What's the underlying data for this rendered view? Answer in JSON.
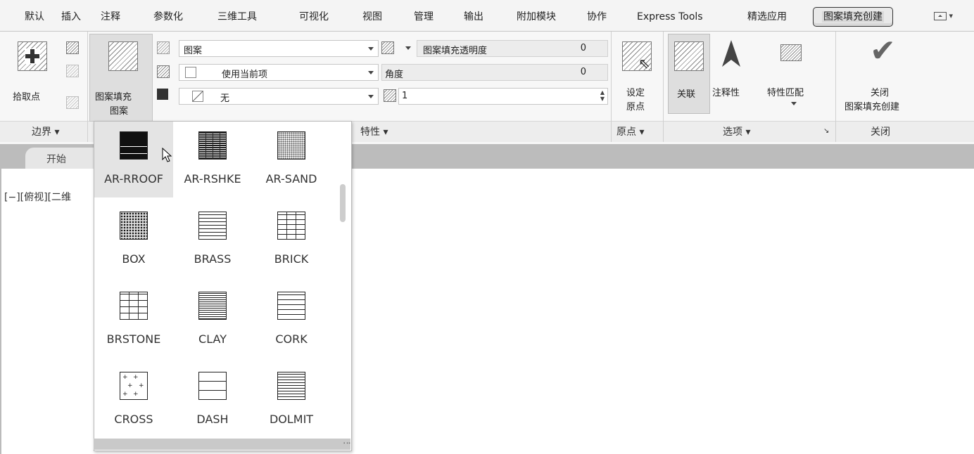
{
  "tabs": [
    "默认",
    "插入",
    "注释",
    "参数化",
    "三维工具",
    "可视化",
    "视图",
    "管理",
    "输出",
    "附加模块",
    "协作",
    "Express Tools",
    "精选应用",
    "图案填充创建"
  ],
  "active_tab": "图案填充创建",
  "boundary": {
    "pick_points_label": "拾取点",
    "title": "边界 ▾"
  },
  "pattern_button": {
    "line1": "图案填充",
    "line2": "图案"
  },
  "properties": {
    "type_value": "图案",
    "color_value": "使用当前项",
    "bg_value": "无",
    "transparency_label": "图案填充透明度",
    "transparency_value": "0",
    "angle_label": "角度",
    "angle_value": "0",
    "scale_value": "1",
    "title": "特性 ▾"
  },
  "origin": {
    "label1": "设定",
    "label2": "原点",
    "title": "原点 ▾"
  },
  "options": {
    "associate": "关联",
    "annotative": "注释性",
    "match": "特性匹配",
    "title": "选项 ▾",
    "launcher": "↘"
  },
  "close_panel": {
    "line1": "关闭",
    "line2": "图案填充创建",
    "title": "关闭"
  },
  "doc_tab": "开始",
  "view_label": "[−][俯视][二维",
  "gallery": {
    "selected": "AR-RROOF",
    "items": [
      "AR-RROOF",
      "AR-RSHKE",
      "AR-SAND",
      "BOX",
      "BRASS",
      "BRICK",
      "BRSTONE",
      "CLAY",
      "CORK",
      "CROSS",
      "DASH",
      "DOLMIT"
    ]
  },
  "icons": [
    "add-point-icon",
    "select-objects-icon",
    "remove-boundary-icon",
    "recreate-boundary-icon",
    "pattern-swatch-icon",
    "hatch-type-icon",
    "hatch-color-icon",
    "hatch-bg-icon",
    "transparency-icon",
    "scale-icon",
    "set-origin-icon",
    "associative-icon",
    "annotative-icon",
    "match-properties-icon",
    "close-check-icon",
    "cursor-icon"
  ]
}
